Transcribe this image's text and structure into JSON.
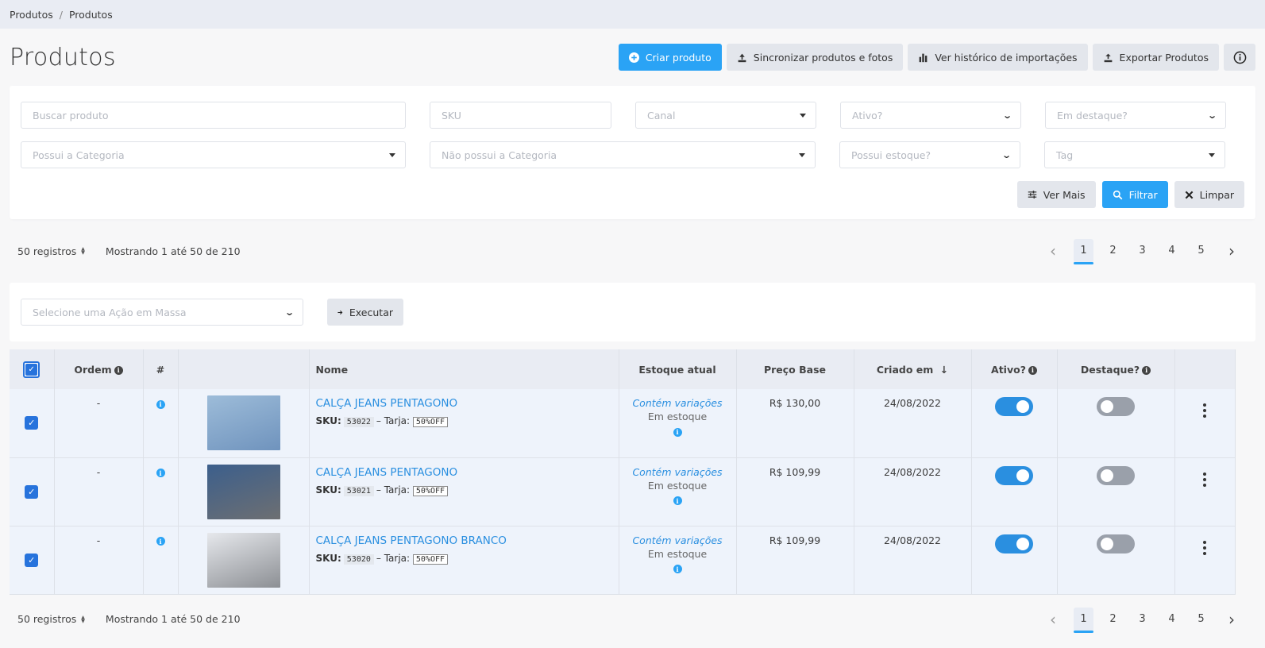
{
  "breadcrumb": [
    "Produtos",
    "Produtos"
  ],
  "page_title": "Produtos",
  "toolbar": {
    "create": "Criar produto",
    "sync": "Sincronizar produtos e fotos",
    "history": "Ver histórico de importações",
    "export": "Exportar Produtos",
    "info_icon": "info-circle-icon"
  },
  "filters": {
    "search_placeholder": "Buscar produto",
    "sku_placeholder": "SKU",
    "canal": "Canal",
    "ativo": "Ativo?",
    "destaque": "Em destaque?",
    "possui_categoria": "Possui a Categoria",
    "nao_possui_categoria": "Não possui a Categoria",
    "possui_estoque": "Possui estoque?",
    "tag": "Tag",
    "ver_mais": "Ver Mais",
    "filtrar": "Filtrar",
    "limpar": "Limpar"
  },
  "pagination": {
    "per_page": "50 registros",
    "summary": "Mostrando 1 até 50 de 210",
    "pages": [
      "1",
      "2",
      "3",
      "4",
      "5"
    ],
    "current": "1"
  },
  "mass_action": {
    "placeholder": "Selecione uma Ação em Massa",
    "execute": "Executar"
  },
  "table": {
    "headers": {
      "ordem": "Ordem",
      "hash": "#",
      "nome": "Nome",
      "estoque": "Estoque atual",
      "preco": "Preço Base",
      "criado": "Criado em",
      "ativo": "Ativo?",
      "destaque": "Destaque?"
    },
    "rows": [
      {
        "ordem": "-",
        "name": "CALÇA JEANS PENTAGONO",
        "sku_label": "SKU:",
        "sku": "53022",
        "tarja_label": "– Tarja:",
        "tarja": "50%OFF",
        "variacoes": "Contém variações",
        "estoque": "Em estoque",
        "preco": "R$ 130,00",
        "criado": "24/08/2022",
        "ativo": true,
        "destaque": false,
        "thumb_colors": [
          "#9dbcd9",
          "#6f93bd"
        ]
      },
      {
        "ordem": "-",
        "name": "CALÇA JEANS PENTAGONO",
        "sku_label": "SKU:",
        "sku": "53021",
        "tarja_label": "– Tarja:",
        "tarja": "50%OFF",
        "variacoes": "Contém variações",
        "estoque": "Em estoque",
        "preco": "R$ 109,99",
        "criado": "24/08/2022",
        "ativo": true,
        "destaque": false,
        "thumb_colors": [
          "#3c5f8c",
          "#6d6f72"
        ]
      },
      {
        "ordem": "-",
        "name": "CALÇA JEANS PENTAGONO BRANCO",
        "sku_label": "SKU:",
        "sku": "53020",
        "tarja_label": "– Tarja:",
        "tarja": "50%OFF",
        "variacoes": "Contém variações",
        "estoque": "Em estoque",
        "preco": "R$ 109,99",
        "criado": "24/08/2022",
        "ativo": true,
        "destaque": false,
        "thumb_colors": [
          "#e6e8ec",
          "#8c8f94"
        ]
      }
    ]
  },
  "colors": {
    "primary": "#2aa3f5",
    "link": "#2a8fe0",
    "checkbox": "#2773dc",
    "toggle_off": "#9aa0aa"
  }
}
